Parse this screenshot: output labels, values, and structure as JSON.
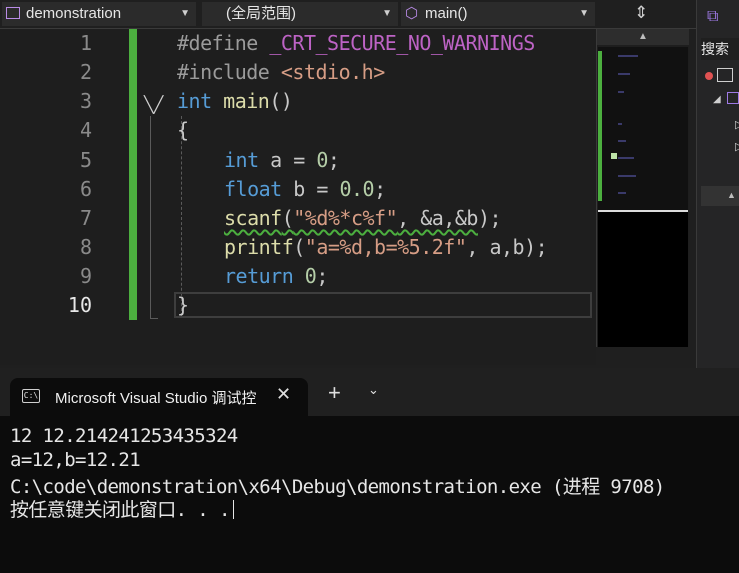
{
  "navbar": {
    "project": "demonstration",
    "scope": "(全局范围)",
    "member": "main()"
  },
  "editor": {
    "line_numbers": [
      "1",
      "2",
      "3",
      "4",
      "5",
      "6",
      "7",
      "8",
      "9",
      "10"
    ],
    "current_line": "10",
    "lines": {
      "l1_directive": "#define",
      "l1_macro": "_CRT_SECURE_NO_WARNINGS",
      "l2_directive": "#include",
      "l2_header": "<stdio.h>",
      "l3_type": "int",
      "l3_name": "main",
      "l3_parens": "()",
      "l4_brace": "{",
      "l5_type": "int",
      "l5_rest": "a = ",
      "l5_num": "0",
      "l5_end": ";",
      "l6_type": "float",
      "l6_rest": "b = ",
      "l6_num": "0.0",
      "l6_end": ";",
      "l7_fn": "scanf",
      "l7_open": "(",
      "l7_str": "\"%d%*c%f\"",
      "l7_args": ", &a,&b",
      "l7_end": ");",
      "l8_fn": "printf",
      "l8_open": "(",
      "l8_str": "\"a=%d,b=%5.2f\"",
      "l8_args": ", a,b",
      "l8_end": ");",
      "l9_kw": "return",
      "l9_num": "0",
      "l9_end": ";",
      "l10_brace": "}"
    }
  },
  "right_panel": {
    "search_label": "搜索"
  },
  "console": {
    "tab_title": "Microsoft Visual Studio 调试控",
    "tab_icon_text": "C:\\",
    "output_lines": [
      "12 12.214241253435324",
      "a=12,b=12.21",
      "C:\\code\\demonstration\\x64\\Debug\\demonstration.exe (进程 9708)",
      "按任意键关闭此窗口. . ."
    ]
  },
  "colors": {
    "change_bar": "#4caf3f",
    "keyword": "#569cd6",
    "string": "#d69d85"
  }
}
